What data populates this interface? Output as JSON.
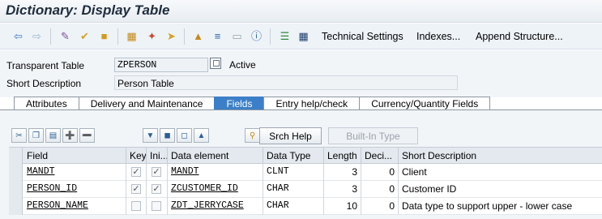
{
  "window": {
    "title": "Dictionary: Display Table"
  },
  "toolbar": {
    "technical_settings": "Technical Settings",
    "indexes": "Indexes...",
    "append_structure": "Append Structure..."
  },
  "header": {
    "table_label": "Transparent Table",
    "table_value": "ZPERSON",
    "status": "Active",
    "desc_label": "Short Description",
    "desc_value": "Person Table"
  },
  "tabs": [
    {
      "label": "Attributes",
      "active": false
    },
    {
      "label": "Delivery and Maintenance",
      "active": false
    },
    {
      "label": "Fields",
      "active": true
    },
    {
      "label": "Entry help/check",
      "active": false
    },
    {
      "label": "Currency/Quantity Fields",
      "active": false
    }
  ],
  "buttons": {
    "srch_help": "Srch Help",
    "built_in_type": "Built-In Type"
  },
  "columns": [
    "Field",
    "Key",
    "Ini...",
    "Data element",
    "Data Type",
    "Length",
    "Deci...",
    "Short Description"
  ],
  "rows": [
    {
      "field": "MANDT",
      "key": true,
      "initial": true,
      "data_element": "MANDT",
      "data_type": "CLNT",
      "length": "3",
      "decimals": "0",
      "description": "Client"
    },
    {
      "field": "PERSON_ID",
      "key": true,
      "initial": true,
      "data_element": "ZCUSTOMER_ID",
      "data_type": "CHAR",
      "length": "3",
      "decimals": "0",
      "description": "Customer ID"
    },
    {
      "field": "PERSON_NAME",
      "key": false,
      "initial": false,
      "data_element": "ZDT_JERRYCASE",
      "data_type": "CHAR",
      "length": "10",
      "decimals": "0",
      "description": "Data type to support upper - lower case"
    }
  ],
  "colors": {
    "accent": "#3c7fc8",
    "title": "#1f2d3d",
    "panel": "#f2f5f8"
  }
}
